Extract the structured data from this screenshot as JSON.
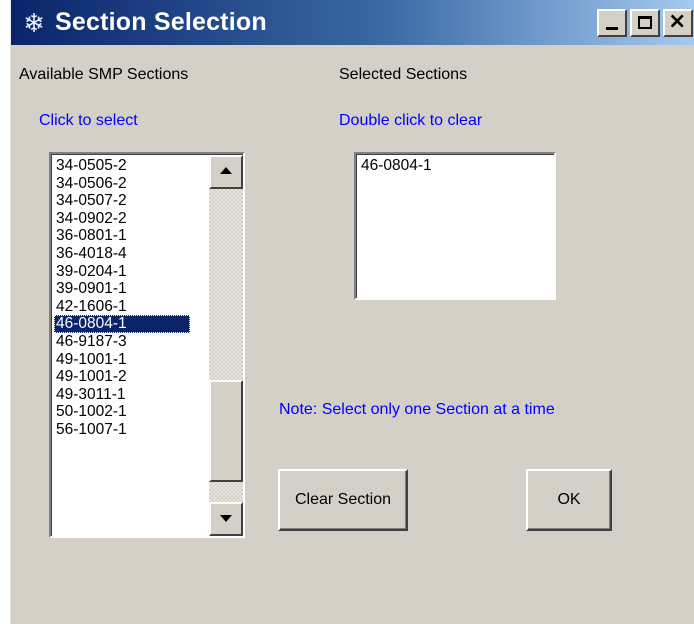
{
  "window": {
    "title": "Section Selection",
    "icon": "snowflake-icon",
    "controls": [
      "minimize",
      "maximize",
      "close"
    ]
  },
  "available": {
    "heading": "Available SMP Sections",
    "hint": "Click to select",
    "items": [
      "34-0505-2",
      "34-0506-2",
      "34-0507-2",
      "34-0902-2",
      "36-0801-1",
      "36-4018-4",
      "39-0204-1",
      "39-0901-1",
      "42-1606-1",
      "46-0804-1",
      "46-9187-3",
      "49-1001-1",
      "49-1001-2",
      "49-3011-1",
      "50-1002-1",
      "56-1007-1"
    ],
    "selected_index": 9,
    "scroll_fraction": 0.9
  },
  "selected": {
    "heading": "Selected Sections",
    "hint": "Double click to clear",
    "items": [
      "46-0804-1"
    ]
  },
  "note": "Note: Select only one Section at a time",
  "buttons": {
    "clear": "Clear Section",
    "ok": "OK"
  },
  "colors": {
    "face": "#d4d0c8",
    "title_start": "#0a246a",
    "title_end": "#a6caf0",
    "hint": "#0000ff",
    "selection": "#0a246a"
  }
}
